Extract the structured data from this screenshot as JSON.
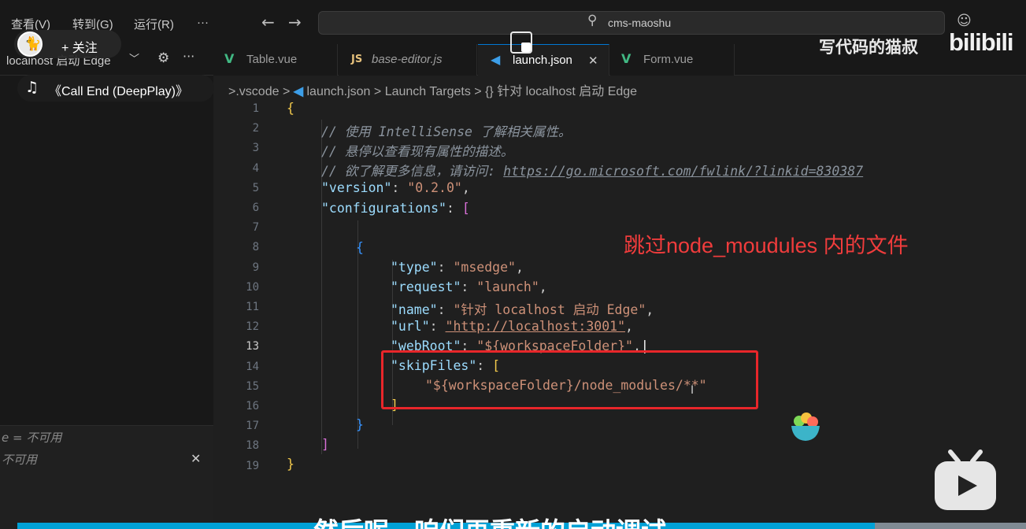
{
  "menu": {
    "view": "查看(V)",
    "goto": "转到(G)",
    "run": "运行(R)",
    "more": "···"
  },
  "nav": {
    "back": "←",
    "forward": "→"
  },
  "command_center": {
    "text": "cms-maoshu"
  },
  "left_panel": {
    "top_label": "localhost 启动 Edge",
    "chevron": "﹀",
    "more": "···",
    "debug_lines": [
      "e = 不可用",
      "不可用"
    ],
    "close": "✕"
  },
  "tabs": [
    {
      "icon": "V",
      "label": "Table.vue"
    },
    {
      "icon": "JS",
      "label": "base-editor.js"
    },
    {
      "icon": "◀",
      "label": "launch.json",
      "close": "✕"
    },
    {
      "icon": "V",
      "label": "Form.vue"
    }
  ],
  "breadcrumb": {
    "prefix": ">",
    "folder": ".vscode",
    "sep": ">",
    "file": "launch.json",
    "targets": "Launch Targets",
    "config": "{} 针对 localhost 启动 Edge"
  },
  "editor": {
    "line_numbers": [
      "1",
      "2",
      "3",
      "4",
      "5",
      "6",
      "7",
      "8",
      "9",
      "10",
      "11",
      "12",
      "13",
      "14",
      "15",
      "16",
      "17",
      "18",
      "19"
    ],
    "current_line": "13",
    "comment1": "// 使用 IntelliSense 了解相关属性。",
    "comment2": "// 悬停以查看现有属性的描述。",
    "comment3_prefix": "// 欲了解更多信息，请访问: ",
    "comment3_link": "https://go.microsoft.com/fwlink/?linkid=830387",
    "version_key": "\"version\"",
    "version_val": "\"0.2.0\"",
    "configurations_key": "\"configurations\"",
    "type_key": "\"type\"",
    "type_val": "\"msedge\"",
    "request_key": "\"request\"",
    "request_val": "\"launch\"",
    "name_key": "\"name\"",
    "name_val": "\"针对 localhost 启动 Edge\"",
    "url_key": "\"url\"",
    "url_val": "\"http://localhost:3001\"",
    "webroot_key": "\"webRoot\"",
    "webroot_val": "\"${workspaceFolder}\"",
    "skipfiles_key": "\"skipFiles\"",
    "skipfiles_val": "\"${workspaceFolder}/node_modules/**\""
  },
  "annotation": "跳过node_moudules 内的文件",
  "overlay": {
    "follow": "+ 关注",
    "music": "《Call End (DeepPlay)》",
    "watermark": "写代码的猫叔",
    "logo": "bilibili",
    "subtitle": "然后呢，咱们再重新的启动调试",
    "progress": 0.85
  },
  "colors": {
    "accent": "#0078d4",
    "annotation_red": "#e8262a",
    "bili_blue": "#00a1d6"
  }
}
